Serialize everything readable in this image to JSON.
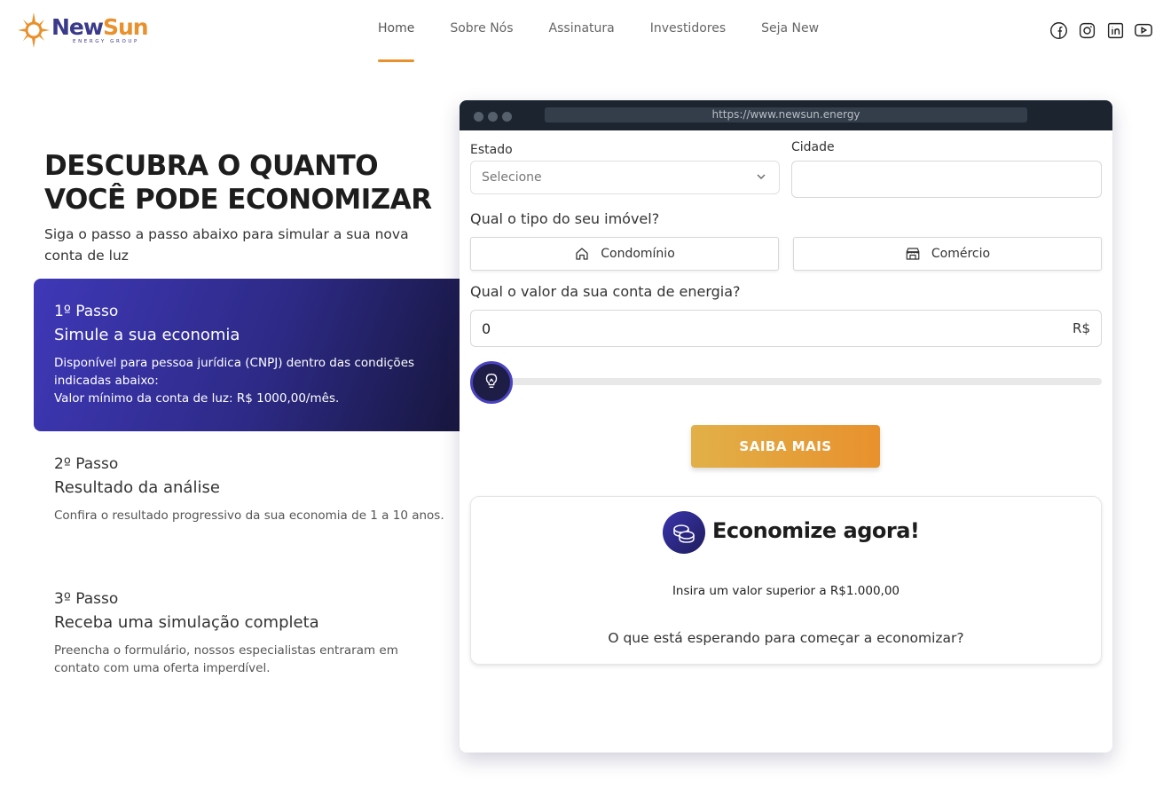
{
  "brand": {
    "name_part1": "New",
    "name_part2": "Sun",
    "tagline": "ENERGY GROUP",
    "accent": "#e8912d",
    "primary": "#3a3a8a"
  },
  "nav": {
    "items": [
      {
        "label": "Home",
        "active": true
      },
      {
        "label": "Sobre Nós",
        "active": false
      },
      {
        "label": "Assinatura",
        "active": false
      },
      {
        "label": "Investidores",
        "active": false
      },
      {
        "label": "Seja New",
        "active": false
      }
    ]
  },
  "social": [
    "facebook-icon",
    "instagram-icon",
    "linkedin-icon",
    "youtube-icon"
  ],
  "hero": {
    "title": "DESCUBRA O QUANTO VOCÊ PODE ECONOMIZAR",
    "subtitle": "Siga o passo a passo abaixo para simular a sua nova conta de luz"
  },
  "steps": [
    {
      "num": "1º Passo",
      "title": "Simule a sua economia",
      "desc": "Disponível para pessoa jurídica (CNPJ) dentro das condições indicadas abaixo:\nValor mínimo da conta de luz: R$ 1000,00/mês.",
      "active": true
    },
    {
      "num": "2º Passo",
      "title": "Resultado da análise",
      "desc": "Confira o resultado progressivo da sua economia de 1 a 10 anos.",
      "active": false
    },
    {
      "num": "3º Passo",
      "title": "Receba uma simulação completa",
      "desc": "Preencha o formulário, nossos especialistas entraram em contato com uma oferta imperdível.",
      "active": false
    }
  ],
  "browser": {
    "url": "https://www.newsun.energy"
  },
  "form": {
    "estado_label": "Estado",
    "estado_value": "Selecione",
    "cidade_label": "Cidade",
    "cidade_value": "",
    "tipo_label": "Qual o tipo do seu imóvel?",
    "tipo_options": [
      "Condomínio",
      "Comércio"
    ],
    "valor_label": "Qual o valor da sua conta de energia?",
    "valor_value": "0",
    "currency": "R$",
    "slider_value": 0,
    "cta_label": "SAIBA MAIS"
  },
  "result": {
    "title": "Economize agora!",
    "note": "Insira um valor superior a R$1.000,00",
    "question": "O que está esperando para começar a economizar?"
  }
}
